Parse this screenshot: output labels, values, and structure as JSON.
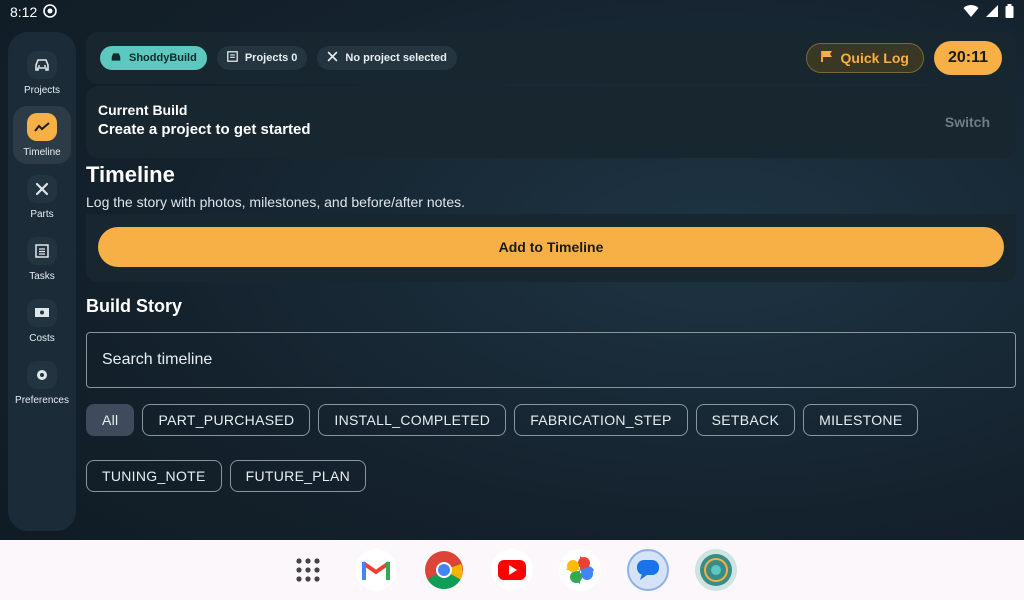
{
  "status": {
    "time": "8:12"
  },
  "rail": {
    "items": [
      {
        "label": "Projects",
        "icon": "car-icon"
      },
      {
        "label": "Timeline",
        "icon": "trend-icon"
      },
      {
        "label": "Parts",
        "icon": "tools-icon"
      },
      {
        "label": "Tasks",
        "icon": "list-icon"
      },
      {
        "label": "Costs",
        "icon": "cash-icon"
      },
      {
        "label": "Preferences",
        "icon": "gear-icon"
      }
    ]
  },
  "topbar": {
    "brand": "ShoddyBuild",
    "projects": "Projects 0",
    "project_status": "No project selected",
    "quick_log": "Quick Log",
    "clock": "20:11"
  },
  "current_build": {
    "label": "Current Build",
    "value": "Create a project to get started",
    "switch": "Switch"
  },
  "timeline": {
    "title": "Timeline",
    "subtitle": "Log the story with photos, milestones, and before/after notes.",
    "add_button": "Add to Timeline"
  },
  "build_story": {
    "title": "Build Story",
    "search_placeholder": "Search timeline",
    "filters_row1": [
      "All",
      "PART_PURCHASED",
      "INSTALL_COMPLETED",
      "FABRICATION_STEP",
      "SETBACK",
      "MILESTONE"
    ],
    "filters_row2": [
      "TUNING_NOTE",
      "FUTURE_PLAN"
    ]
  },
  "colors": {
    "accent": "#f7b046",
    "brand": "#5cc8c0",
    "background": "#14222d"
  }
}
